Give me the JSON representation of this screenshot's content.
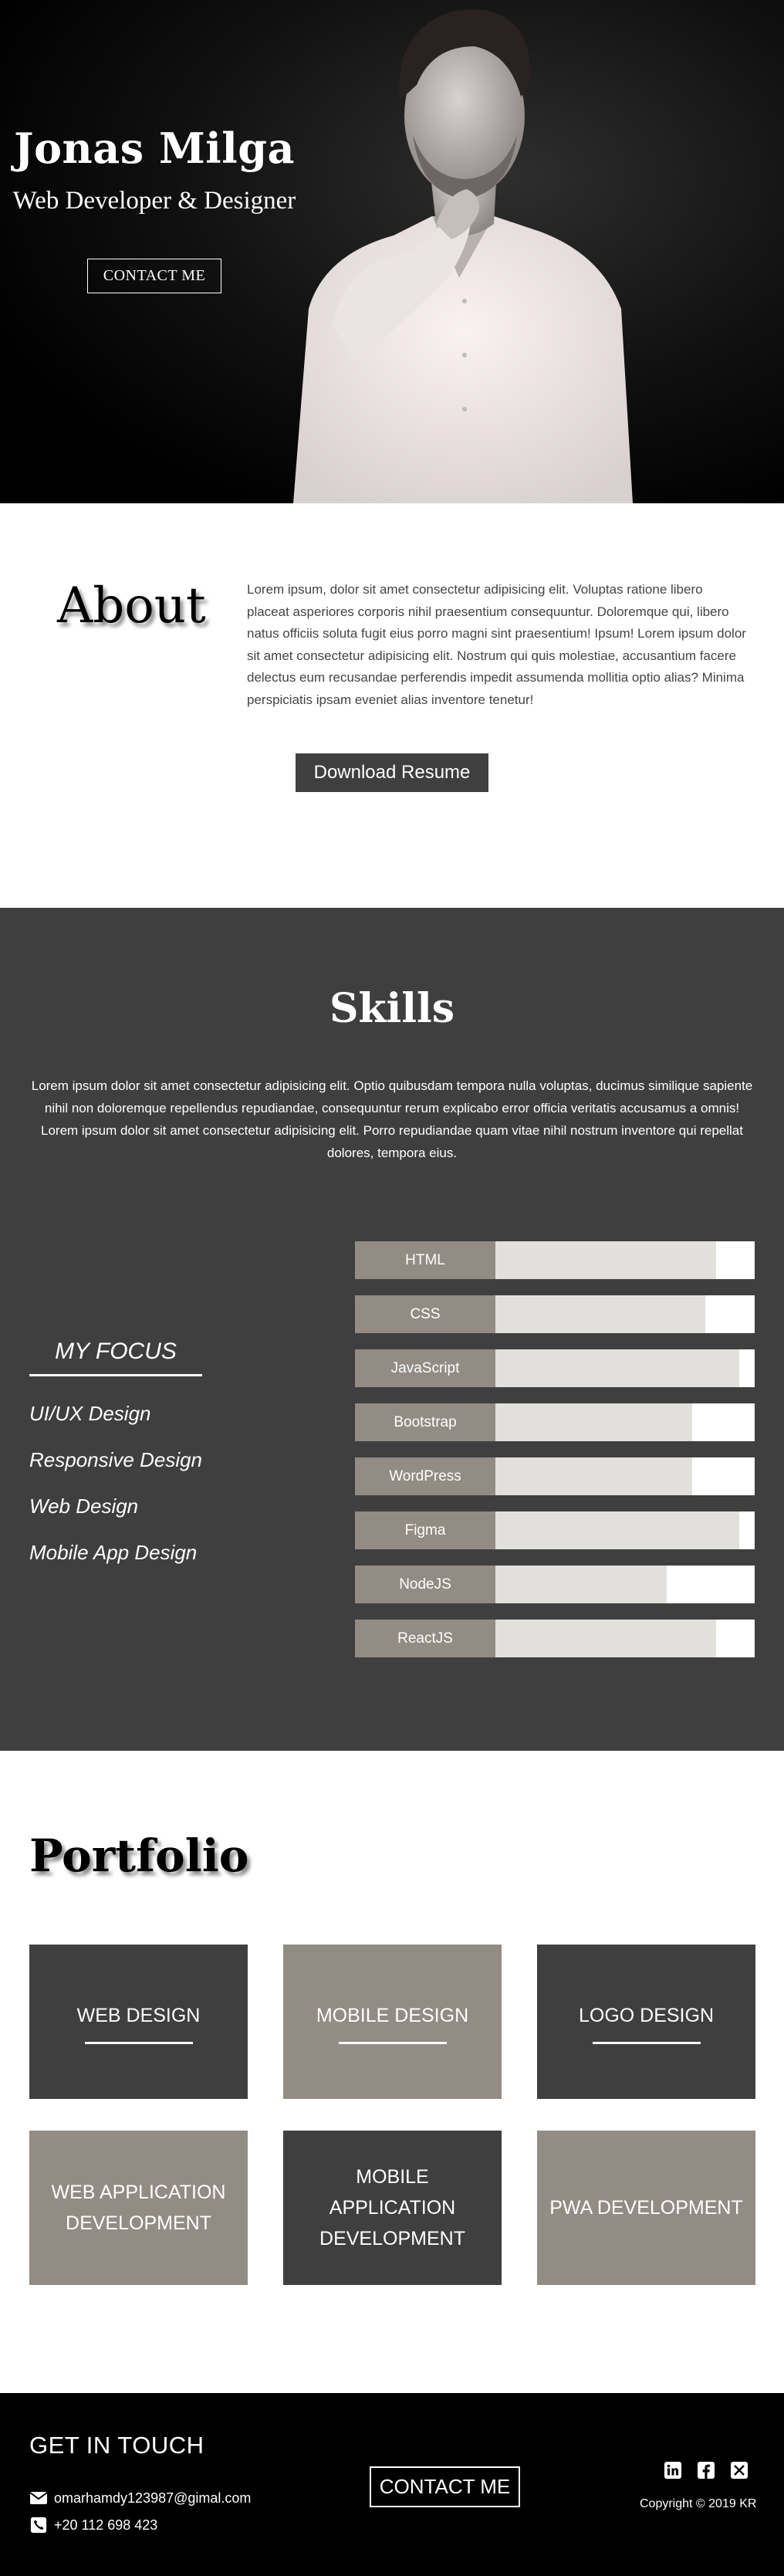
{
  "hero": {
    "name": "Jonas Milga",
    "role": "Web Developer & Designer",
    "cta_label": "CONTACT ME"
  },
  "about": {
    "title": "About",
    "text": "Lorem ipsum, dolor sit amet consectetur adipisicing elit. Voluptas ratione libero placeat asperiores corporis nihil praesentium consequuntur. Doloremque qui, libero natus officiis soluta fugit eius porro magni sint praesentium! Ipsum! Lorem ipsum dolor sit amet consectetur adipisicing elit. Nostrum qui quis molestiae, accusantium facere delectus eum recusandae perferendis impedit assumenda mollitia optio alias? Minima perspiciatis ipsam eveniet alias inventore tenetur!",
    "download_label": "Download Resume"
  },
  "skills": {
    "title": "Skills",
    "text": "Lorem ipsum dolor sit amet consectetur adipisicing elit. Optio quibusdam tempora nulla voluptas, ducimus similique sapiente nihil non doloremque repellendus repudiandae, consequuntur rerum explicabo error officia veritatis accusamus a omnis! Lorem ipsum dolor sit amet consectetur adipisicing elit. Porro repudiandae quam vitae nihil nostrum inventore qui repellat dolores, tempora eius.",
    "focus_title": "MY FOCUS",
    "focus_items": [
      "UI/UX Design",
      "Responsive Design",
      "Web Design",
      "Mobile App Design"
    ],
    "bars": [
      {
        "label": "HTML",
        "level": 0.85
      },
      {
        "label": "CSS",
        "level": 0.81
      },
      {
        "label": "JavaScript",
        "level": 0.94
      },
      {
        "label": "Bootstrap",
        "level": 0.76
      },
      {
        "label": "WordPress",
        "level": 0.76
      },
      {
        "label": "Figma",
        "level": 0.94
      },
      {
        "label": "NodeJS",
        "level": 0.66
      },
      {
        "label": "ReactJS",
        "level": 0.85
      }
    ]
  },
  "portfolio": {
    "title": "Portfolio",
    "cards": [
      {
        "label": "WEB DESIGN",
        "style": "dark",
        "underline": true
      },
      {
        "label": "MOBILE DESIGN",
        "style": "light",
        "underline": true
      },
      {
        "label": "LOGO DESIGN",
        "style": "dark",
        "underline": true
      },
      {
        "label": "WEB APPLICATION DEVELOPMENT",
        "style": "light",
        "underline": false
      },
      {
        "label": "MOBILE APPLICATION DEVELOPMENT",
        "style": "dark",
        "underline": false
      },
      {
        "label": "PWA DEVELOPMENT",
        "style": "light",
        "underline": false
      }
    ]
  },
  "footer": {
    "title": "GET IN TOUCH",
    "email": "omarhamdy123987@gimal.com",
    "phone": "+20 112 698 423",
    "cta_label": "CONTACT ME",
    "socials": [
      "linkedin-icon",
      "facebook-icon",
      "x-icon"
    ],
    "copyright": "Copyright © 2019 KR"
  },
  "colors": {
    "dark": "#3f3f3f",
    "taupe": "#928c84",
    "bar_fill": "#e2e0dc"
  }
}
